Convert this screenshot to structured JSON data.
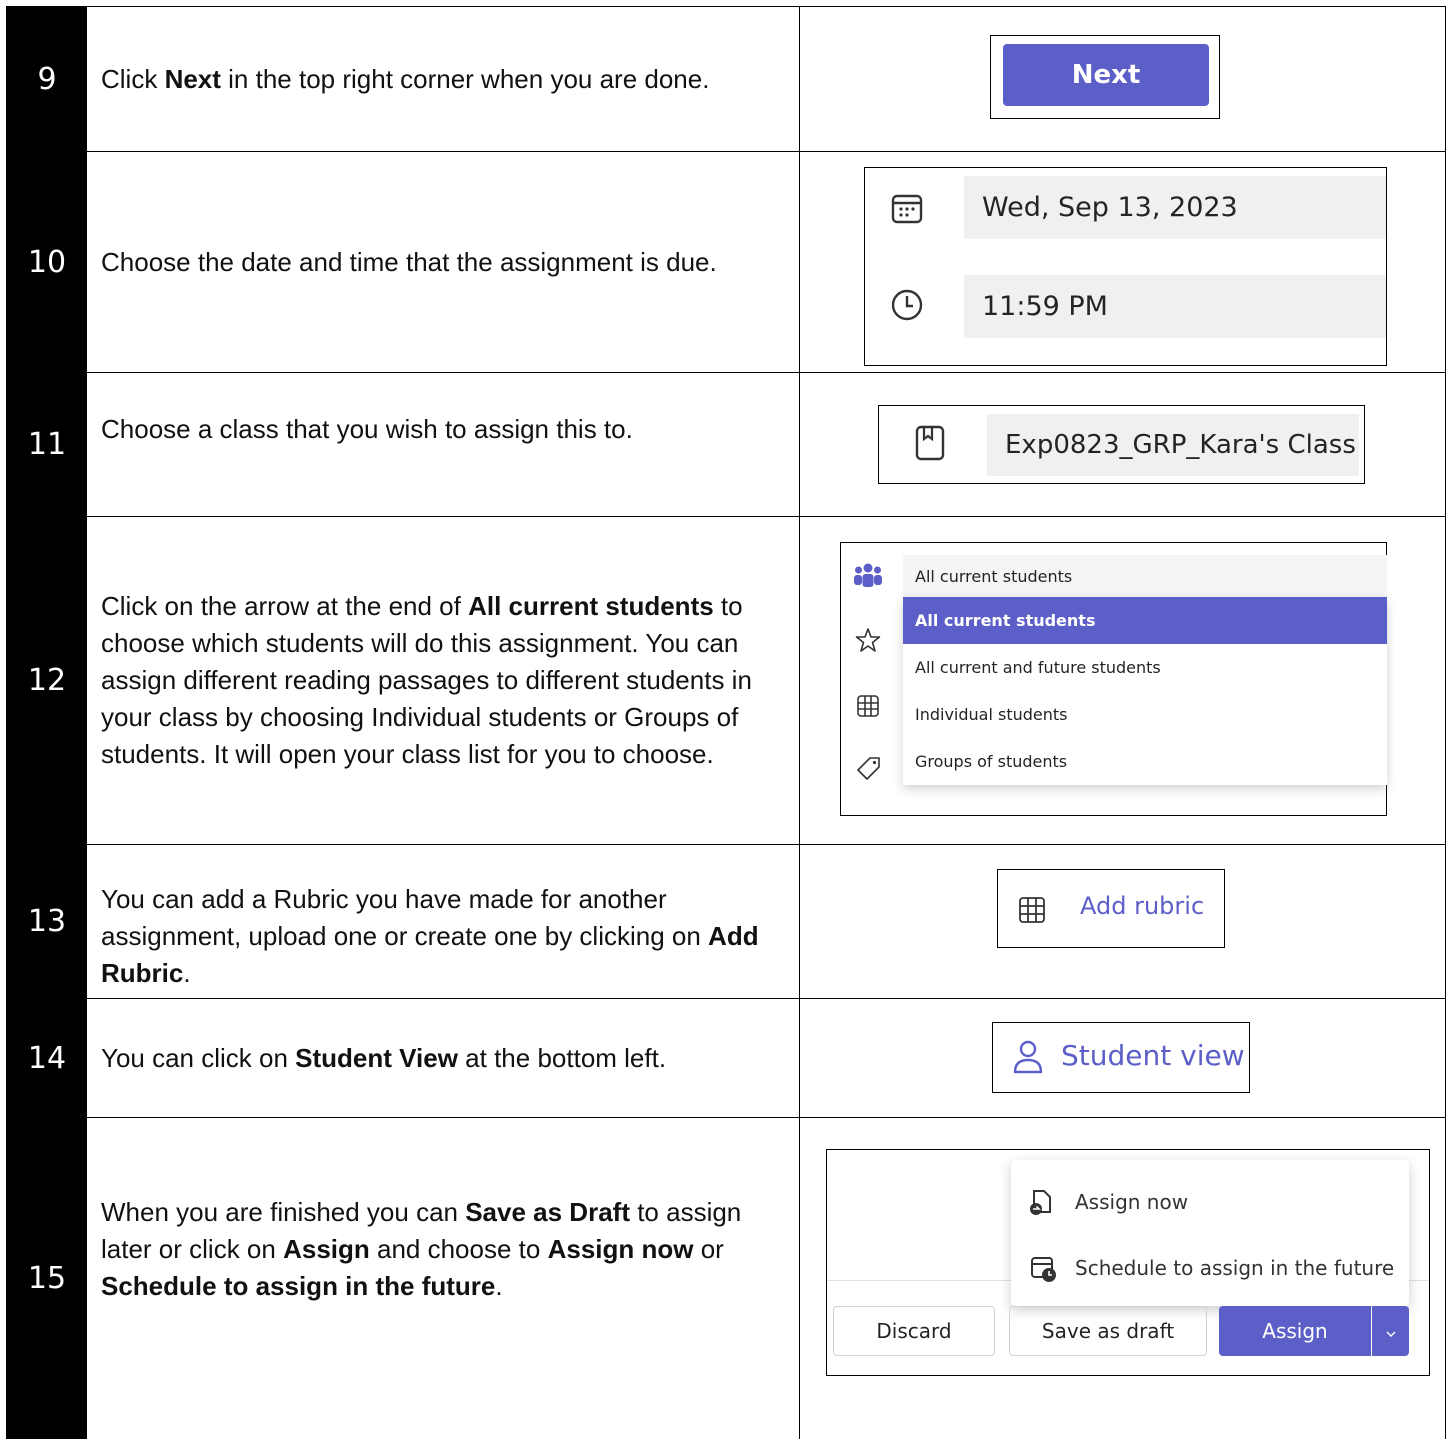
{
  "rows": [
    {
      "num": "9",
      "pre": "Click ",
      "bold": "Next",
      "post": " in the top right corner when you are done."
    },
    {
      "num": "10",
      "text": "Choose the date and time that the assignment is due."
    },
    {
      "num": "11",
      "text": "Choose a class that you wish to assign this to."
    },
    {
      "num": "12",
      "pre": "Click on the arrow at the end of ",
      "bold": "All current students",
      "post": " to choose which students will do this assignment.  You can assign different reading passages to different students in your class by choosing Individual students or Groups of students.  It will open your class list for you to choose."
    },
    {
      "num": "13",
      "pre": "You can add a Rubric you have made for another assignment, upload one or create one by clicking on ",
      "bold": "Add Rubric",
      "post": "."
    },
    {
      "num": "14",
      "pre": "You can click on ",
      "bold": "Student View",
      "post": " at the bottom left."
    },
    {
      "num": "15",
      "pre": "When you are finished you can ",
      "bold1": "Save as Draft",
      "mid1": " to assign later or click on ",
      "bold2": "Assign",
      "mid2": " and choose to ",
      "bold3": "Assign now",
      "mid3": " or ",
      "bold4": "Schedule to assign in the future",
      "post": "."
    }
  ],
  "next_button": "Next",
  "due_date": "Wed, Sep 13, 2023",
  "due_time": "11:59 PM",
  "class_name": "Exp0823_GRP_Kara's Class",
  "students_dropdown": {
    "current": "All current students",
    "options": [
      "All current students",
      "All current and future students",
      "Individual students",
      "Groups of students"
    ]
  },
  "add_rubric": "Add rubric",
  "student_view": "Student view",
  "assign_menu": {
    "assign_now": "Assign now",
    "schedule": "Schedule to assign in the future",
    "discard": "Discard",
    "save_draft": "Save as draft",
    "assign": "Assign"
  },
  "colors": {
    "accent": "#5b5fc7",
    "field_bg": "#f0f0f0"
  }
}
